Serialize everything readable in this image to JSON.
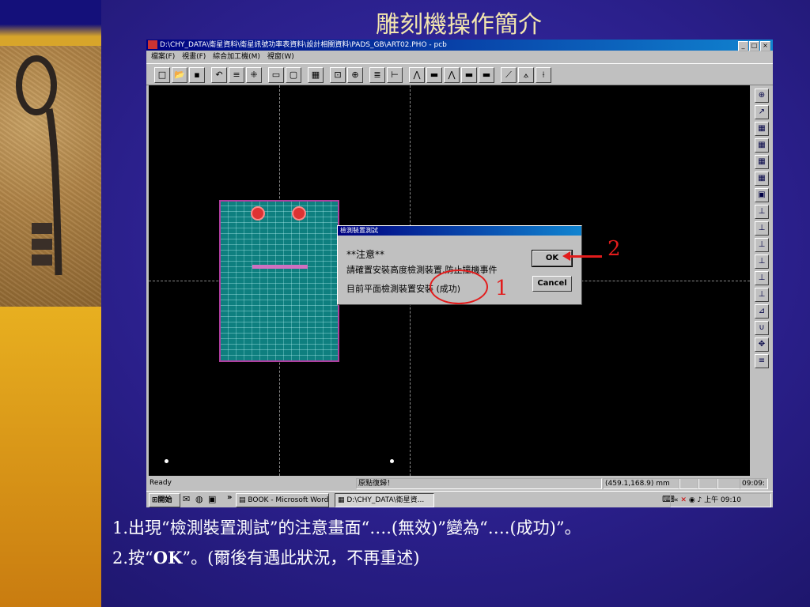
{
  "slide": {
    "title": "雕刻機操作簡介",
    "caption_line1": "1.出現“檢測裝置測試”的注意畫面“….(無效)”變為“….(成功)”。",
    "caption_line2_prefix": "2.按“",
    "caption_line2_bold": "OK",
    "caption_line2_suffix": "”。(爾後有遇此狀況，不再重述)"
  },
  "app": {
    "title": "D:\\CHY_DATA\\衛星資料\\衛星訊號功率表資料\\設計相關資料\\PADS_GB\\ART02.PHO - pcb",
    "window_buttons": [
      "_",
      "□",
      "×"
    ],
    "menu": [
      "檔案(F)",
      "視畫(F)",
      "綜合加工機(M)",
      "視窗(W)"
    ]
  },
  "toolbar_icons": [
    "new-file-icon",
    "open-folder-icon",
    "save-icon",
    "undo-icon",
    "layers-icon",
    "grid-icon",
    "rect-icon",
    "frame-icon",
    "table-icon",
    "zoom-icon",
    "zoom-in-icon",
    "color-icon",
    "align-icon",
    "drill1-icon",
    "drill2-icon",
    "drill3-icon",
    "drill4-icon",
    "drill5-icon",
    "tool-a-icon",
    "tool-b-icon",
    "tool-c-icon"
  ],
  "right_tools": [
    {
      "name": "home-icon",
      "glyph": "⊕"
    },
    {
      "name": "export-icon",
      "glyph": "↗"
    },
    {
      "name": "layer1-icon",
      "glyph": "▦"
    },
    {
      "name": "layer2-icon",
      "glyph": "▦"
    },
    {
      "name": "layer3-icon",
      "glyph": "▦"
    },
    {
      "name": "layer4-icon",
      "glyph": "▦"
    },
    {
      "name": "chip-icon",
      "glyph": "▣"
    },
    {
      "name": "probe1-icon",
      "glyph": "⊥"
    },
    {
      "name": "probe2-icon",
      "glyph": "⊥"
    },
    {
      "name": "probe3-icon",
      "glyph": "⊥"
    },
    {
      "name": "probe4-icon",
      "glyph": "⊥"
    },
    {
      "name": "probe5-icon",
      "glyph": "⊥"
    },
    {
      "name": "probe6-icon",
      "glyph": "⊥"
    },
    {
      "name": "ruler-icon",
      "glyph": "⊿"
    },
    {
      "name": "magnet-icon",
      "glyph": "∪"
    },
    {
      "name": "move-icon",
      "glyph": "✥"
    },
    {
      "name": "settings-icon",
      "glyph": "≡"
    }
  ],
  "dialog": {
    "title": "檢測裝置測試",
    "line1": "**注意**",
    "line2": "請確置安裝高度檢測裝置,防止撞機事件",
    "line3": "目前平面檢測裝置安裝 (成功)",
    "ok_label": "OK",
    "cancel_label": "Cancel"
  },
  "annotations": {
    "circle_label": "1",
    "arrow_label": "2",
    "color": "#e21c1c"
  },
  "status": {
    "ready": "Ready",
    "message": "原點復歸！",
    "coords": "(459.1,168.9) mm",
    "time_cut": "09:09:"
  },
  "taskbar": {
    "start": "開始",
    "more": "»",
    "word_task": "BOOK - Microsoft Word",
    "app_task": "D:\\CHY_DATA\\衛星資...",
    "tray_arrow": "«",
    "clock": "上午 09:10"
  },
  "colors": {
    "title_gold": "#f3e6ae",
    "pcb_teal": "#0e7f7f",
    "pcb_border": "#b03d9e"
  }
}
